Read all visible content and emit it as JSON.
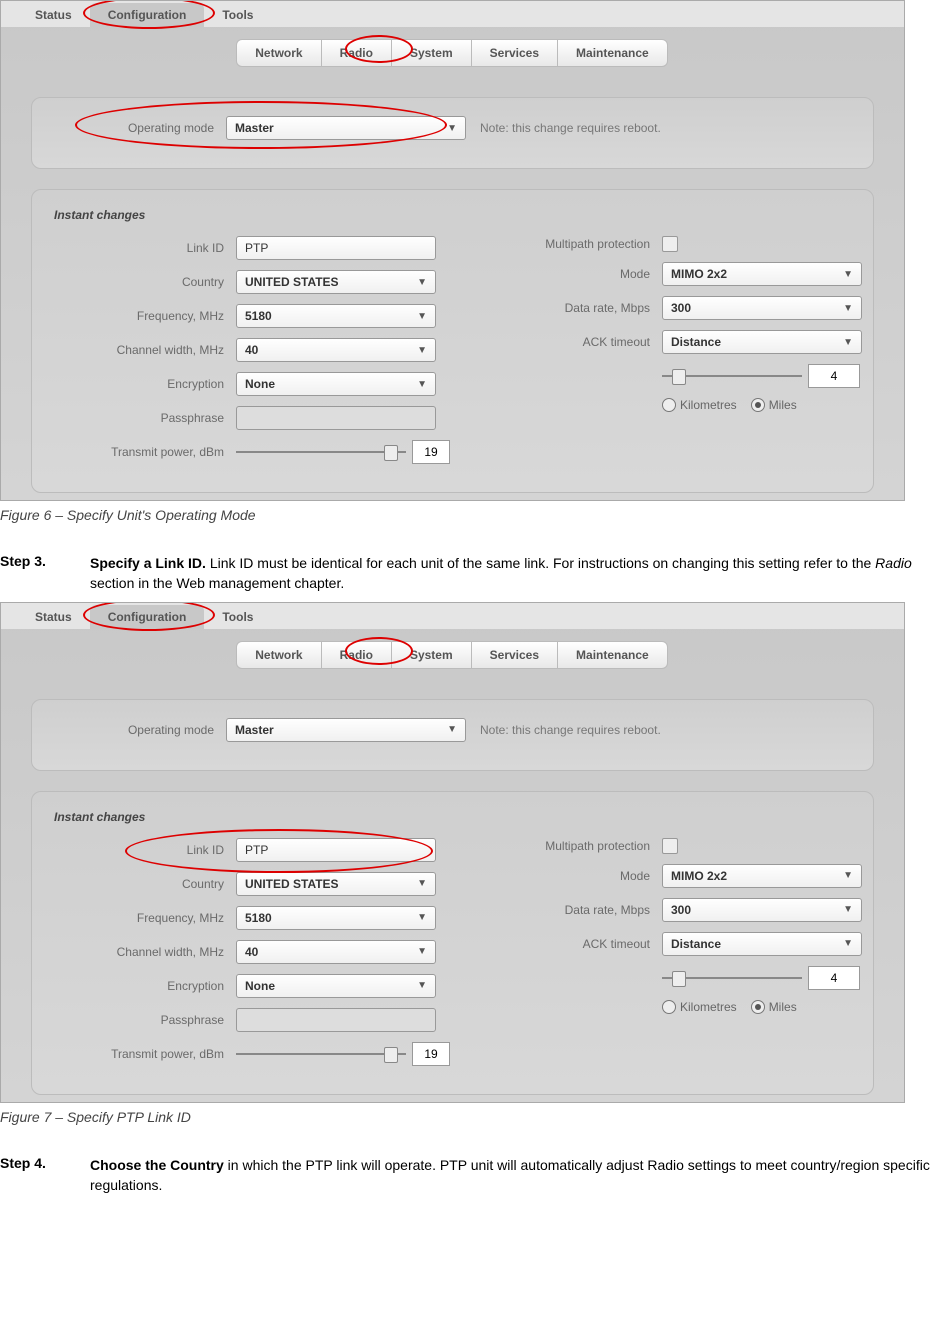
{
  "doc": {
    "figure6_caption": "Figure 6 – Specify Unit's Operating Mode",
    "figure7_caption": "Figure 7 – Specify PTP Link ID",
    "step3_label": "Step 3.",
    "step3_bold": "Specify a Link ID.",
    "step3_rest": " Link ID must be identical for each unit of the same link. For instructions on changing this setting refer to the ",
    "step3_em": "Radio",
    "step3_rest2": " section in the Web management chapter.",
    "step4_label": "Step 4.",
    "step4_bold": "Choose the Country",
    "step4_rest": " in which the PTP link will operate. PTP unit will automatically adjust Radio settings to meet country/region specific regulations."
  },
  "tabs": {
    "status": "Status",
    "configuration": "Configuration",
    "tools": "Tools"
  },
  "subtabs": {
    "network": "Network",
    "radio": "Radio",
    "system": "System",
    "services": "Services",
    "maintenance": "Maintenance"
  },
  "panel1": {
    "operating_mode_label": "Operating mode",
    "operating_mode_value": "Master",
    "note": "Note: this change requires reboot."
  },
  "panel2": {
    "title": "Instant changes",
    "link_id_label": "Link ID",
    "link_id_value": "PTP",
    "country_label": "Country",
    "country_value": "UNITED STATES",
    "frequency_label": "Frequency, MHz",
    "frequency_value": "5180",
    "channel_width_label": "Channel width, MHz",
    "channel_width_value": "40",
    "encryption_label": "Encryption",
    "encryption_value": "None",
    "passphrase_label": "Passphrase",
    "passphrase_value": "",
    "tx_power_label": "Transmit power, dBm",
    "tx_power_value": "19",
    "multipath_label": "Multipath protection",
    "mode_label": "Mode",
    "mode_value": "MIMO 2x2",
    "data_rate_label": "Data rate, Mbps",
    "data_rate_value": "300",
    "ack_timeout_label": "ACK timeout",
    "ack_timeout_value": "Distance",
    "distance_value": "4",
    "units_km": "Kilometres",
    "units_mi": "Miles"
  }
}
